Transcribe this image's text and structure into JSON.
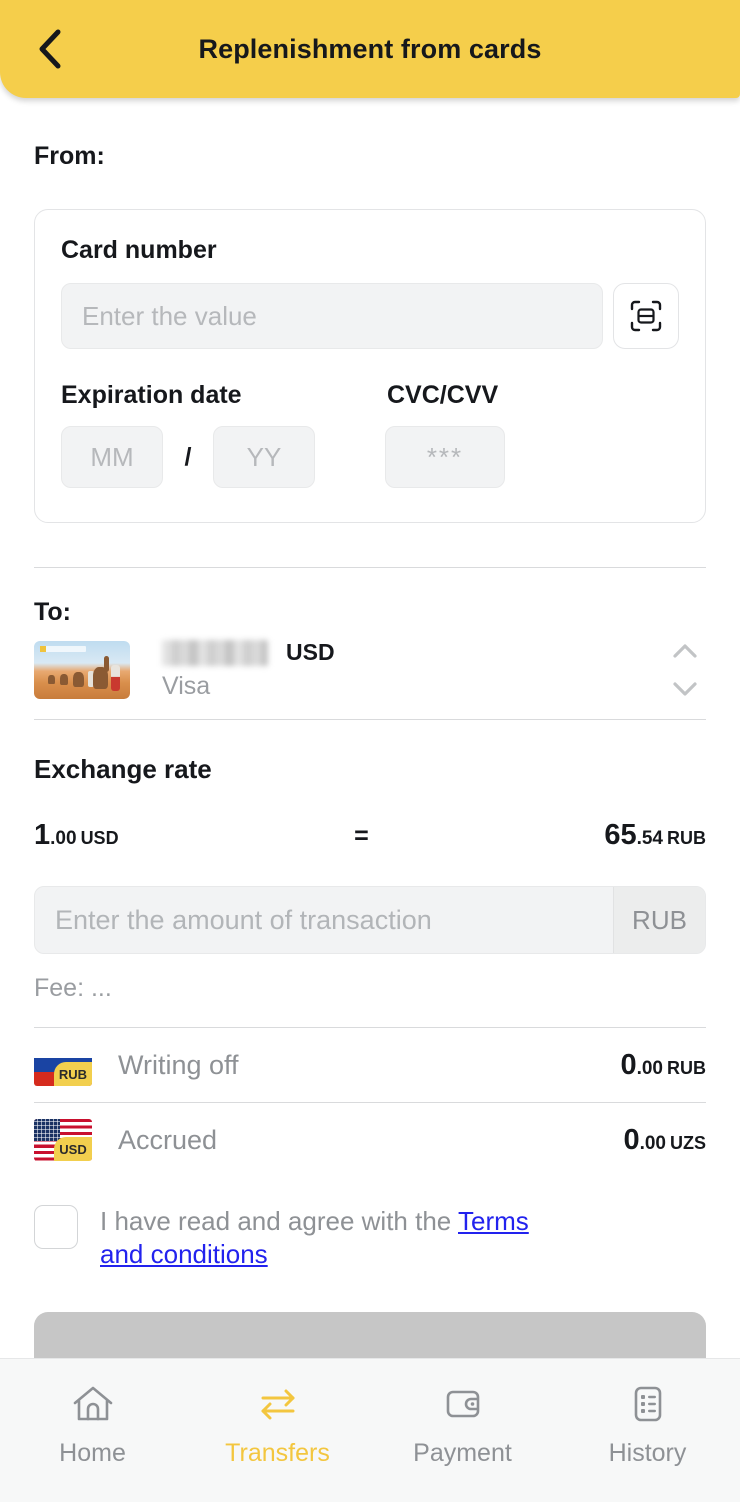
{
  "header": {
    "title": "Replenishment from cards",
    "back_icon": "chevron-left-icon",
    "accent_color": "#F5CE4B"
  },
  "from": {
    "label": "From:",
    "card_number": {
      "label": "Card number",
      "value": "",
      "placeholder": "Enter the value",
      "scan_icon": "card-scan-icon"
    },
    "expiration": {
      "label": "Expiration date",
      "month_value": "",
      "month_placeholder": "MM",
      "separator": "/",
      "year_value": "",
      "year_placeholder": "YY"
    },
    "cvv": {
      "label": "CVC/CVV",
      "value": "",
      "placeholder": "***"
    }
  },
  "to": {
    "label": "To:",
    "card_thumb_icon": "card-desert-camels-thumbnail",
    "masked_number": "",
    "currency": "USD",
    "payment_system": "Visa",
    "stepper_icon": "chevron-up-down-icon"
  },
  "exchange": {
    "title": "Exchange rate",
    "from_int": "1",
    "from_dec": ".00",
    "from_cur": "USD",
    "equals": "=",
    "to_int": "65",
    "to_dec": ".54",
    "to_cur": "RUB"
  },
  "amount": {
    "value": "",
    "placeholder": "Enter the amount of transaction",
    "currency": "RUB",
    "fee": "Fee: ..."
  },
  "summary": [
    {
      "flag_icon": "flag-russia-icon",
      "tag": "RUB",
      "label": "Writing off",
      "int": "0",
      "dec": ".00",
      "cur": "RUB"
    },
    {
      "flag_icon": "flag-usa-icon",
      "tag": "USD",
      "label": "Accrued",
      "int": "0",
      "dec": ".00",
      "cur": "UZS"
    }
  ],
  "terms": {
    "checked": false,
    "text": "I have read and agree with the ",
    "link": "Terms and conditions"
  },
  "submit": {
    "label": "",
    "enabled": false
  },
  "bottom_nav": {
    "items": [
      {
        "label": "Home",
        "icon": "home-icon",
        "active": false
      },
      {
        "label": "Transfers",
        "icon": "transfer-arrows-icon",
        "active": true
      },
      {
        "label": "Payment",
        "icon": "wallet-icon",
        "active": false
      },
      {
        "label": "History",
        "icon": "list-document-icon",
        "active": false
      }
    ],
    "active_color": "#F3C63F"
  }
}
